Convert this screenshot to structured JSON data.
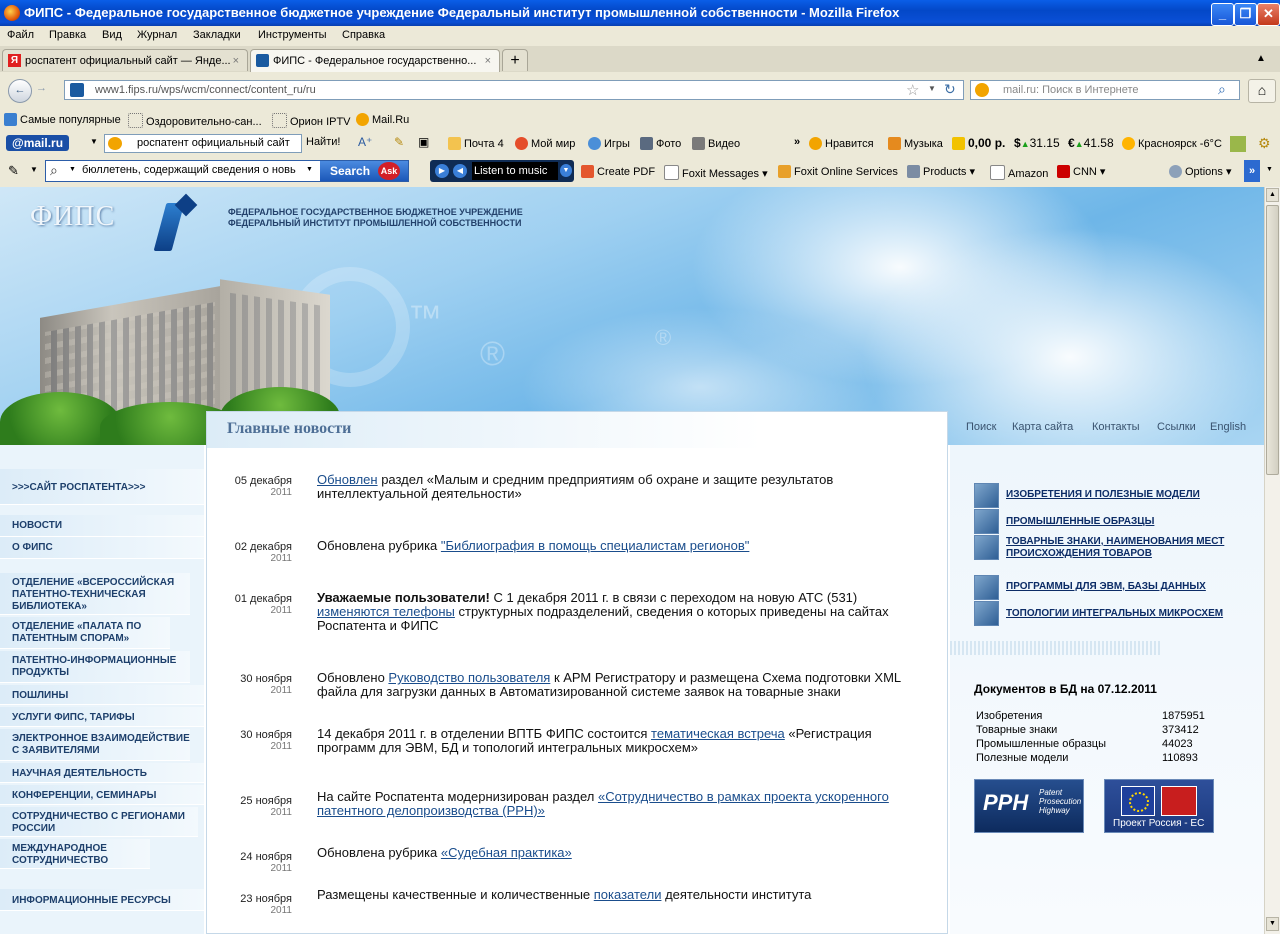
{
  "window": {
    "title": "ФИПС - Федеральное государственное бюджетное учреждение Федеральный институт промышленной собственности - Mozilla Firefox",
    "controls": {
      "minimize": "_",
      "maximize": "❐",
      "close": "✕"
    }
  },
  "menu": [
    "Файл",
    "Правка",
    "Вид",
    "Журнал",
    "Закладки",
    "Инструменты",
    "Справка"
  ],
  "tabs": [
    {
      "label": "роспатент официальный сайт — Янде...",
      "active": false
    },
    {
      "label": "ФИПС - Федеральное государственно...",
      "active": true
    }
  ],
  "tab_close": "×",
  "new_tab": "+",
  "nav": {
    "url": "www1.fips.ru/wps/wcm/connect/content_ru/ru",
    "search_placeholder": "mail.ru: Поиск в Интернете"
  },
  "bookmarks": [
    "Самые популярные",
    "Оздоровительно-сан...",
    "Орион IPTV",
    "Mail.Ru"
  ],
  "mailru_toolbar": {
    "logo": "@mail.ru",
    "search_value": "роспатент официальный сайт",
    "find_button": "Найти!",
    "mail": "Почта 4",
    "moi_mir": "Мой мир",
    "games": "Игры",
    "photo": "Фото",
    "video": "Видео",
    "more": "»",
    "like": "Нравится",
    "music": "Музыка",
    "balance": "0,00 р.",
    "usd": "31.15",
    "eur": "41.58",
    "weather": "Красноярск -6°C"
  },
  "ask_toolbar": {
    "search_value": "бюллетень, содержащий сведения о новь",
    "search_button": "Search",
    "listen": "Listen to music",
    "create_pdf": "Create PDF",
    "foxit_messages": "Foxit Messages",
    "foxit_online": "Foxit Online Services",
    "products": "Products",
    "amazon": "Amazon",
    "cnn": "CNN",
    "options": "Options",
    "more": "»"
  },
  "site": {
    "logo_text": "ФИПС",
    "org_line1": "ФЕДЕРАЛЬНОЕ ГОСУДАРСТВЕННОЕ БЮДЖЕТНОЕ УЧРЕЖДЕНИЕ",
    "org_line2": "ФЕДЕРАЛЬНЫЙ ИНСТИТУТ ПРОМЫШЛЕННОЙ СОБСТВЕННОСТИ",
    "top_links": [
      "Поиск",
      "Карта сайта",
      "Контакты",
      "Ссылки",
      "English"
    ],
    "left_nav": [
      ">>>САЙТ РОСПАТЕНТА>>>",
      "НОВОСТИ",
      "О ФИПС",
      "ОТДЕЛЕНИЕ «ВСЕРОССИЙСКАЯ ПАТЕНТНО-ТЕХНИЧЕСКАЯ БИБЛИОТЕКА»",
      "ОТДЕЛЕНИЕ «ПАЛАТА ПО ПАТЕНТНЫМ СПОРАМ»",
      "ПАТЕНТНО-ИНФОРМАЦИОННЫЕ ПРОДУКТЫ",
      "ПОШЛИНЫ",
      "УСЛУГИ ФИПС, ТАРИФЫ",
      "ЭЛЕКТРОННОЕ ВЗАИМОДЕЙСТВИЕ С ЗАЯВИТЕЛЯМИ",
      "НАУЧНАЯ ДЕЯТЕЛЬНОСТЬ",
      "КОНФЕРЕНЦИИ, СЕМИНАРЫ",
      "СОТРУДНИЧЕСТВО С РЕГИОНАМИ РОССИИ",
      "МЕЖДУНАРОДНОЕ СОТРУДНИЧЕСТВО",
      "ИНФОРМАЦИОННЫЕ РЕСУРСЫ"
    ],
    "news_title": "Главные новости",
    "news": [
      {
        "date": "05 декабря",
        "year": "2011",
        "link": "Обновлен",
        "pre": "",
        "post": "  раздел «Малым и средним предприятиям об охране и защите результатов интеллектуальной деятельности»"
      },
      {
        "date": "02 декабря",
        "year": "2011",
        "pre": "Обновлена рубрика ",
        "link": "\"Библиография в помощь специалистам регионов\"",
        "post": ""
      },
      {
        "date": "01 декабря",
        "year": "2011",
        "bold": "Уважаемые пользователи!",
        "pre": " С 1 декабря 2011 г. в связи с переходом на новую АТС (531) ",
        "link": "изменяются телефоны",
        "post": " структурных подразделений, сведения о которых приведены на сайтах Роспатента и ФИПС"
      },
      {
        "date": "30 ноября",
        "year": "2011",
        "pre": "Обновлено ",
        "link": "Руководство пользователя",
        "post": " к АРМ Регистратору и размещена Схема подготовки XML файла для загрузки данных в Автоматизированной системе заявок на товарные знаки"
      },
      {
        "date": "30 ноября",
        "year": "2011",
        "pre": "14 декабря 2011 г. в отделении ВПТБ ФИПС состоится ",
        "link": "тематическая встреча",
        "post": " «Регистрация программ для ЭВМ, БД и топологий интегральных микросхем»"
      },
      {
        "date": "25 ноября",
        "year": "2011",
        "pre": "На сайте Роспатента модернизирован раздел ",
        "link": "«Сотрудничество в рамках проекта ускоренного патентного делопроизводства (PPH)»",
        "post": ""
      },
      {
        "date": "24 ноября",
        "year": "2011",
        "pre": "Обновлена рубрика ",
        "link": "«Судебная практика»",
        "post": ""
      },
      {
        "date": "23 ноября",
        "year": "2011",
        "pre": "Размещены качественные и количественные ",
        "link": "показатели",
        "post": " деятельности института"
      }
    ],
    "right_links": [
      "ИЗОБРЕТЕНИЯ И ПОЛЕЗНЫЕ МОДЕЛИ",
      "ПРОМЫШЛЕННЫЕ ОБРАЗЦЫ",
      "ТОВАРНЫЕ ЗНАКИ, НАИМЕНОВАНИЯ МЕСТ ПРОИСХОЖДЕНИЯ ТОВАРОВ",
      "ПРОГРАММЫ ДЛЯ ЭВМ, БАЗЫ ДАННЫХ",
      "ТОПОЛОГИИ ИНТЕГРАЛЬНЫХ МИКРОСХЕМ"
    ],
    "db_title": "Документов в БД на 07.12.2011",
    "db_stats": [
      {
        "label": "Изобретения",
        "value": "1875951"
      },
      {
        "label": "Товарные знаки",
        "value": "373412"
      },
      {
        "label": "Промышленные образцы",
        "value": "44023"
      },
      {
        "label": "Полезные модели",
        "value": "110893"
      }
    ],
    "pph_banner": {
      "logo": "PPH",
      "text1": "Patent",
      "text2": "Prosecution",
      "text3": "Highway"
    },
    "eu_banner": "Проект Россия - ЕС"
  }
}
